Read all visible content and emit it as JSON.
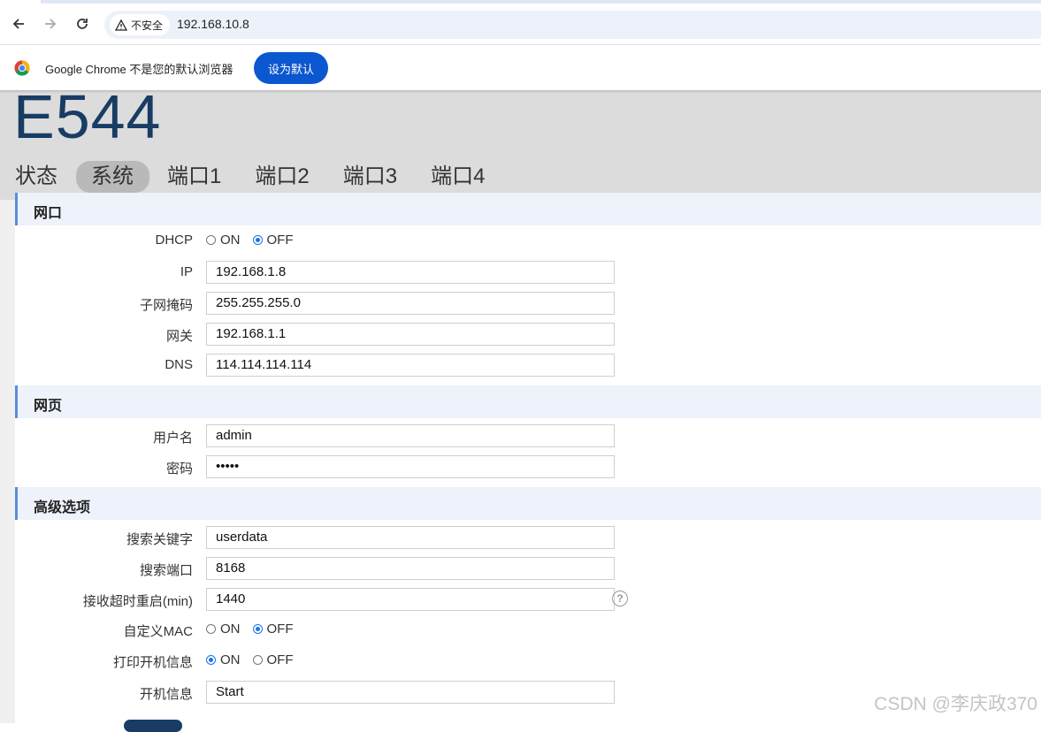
{
  "browser": {
    "security_label": "不安全",
    "url": "192.168.10.8",
    "infobar_text": "Google Chrome 不是您的默认浏览器",
    "set_default_label": "设为默认"
  },
  "header": {
    "brand": "E544",
    "nav": [
      {
        "label": "状态",
        "active": false
      },
      {
        "label": "系统",
        "active": true
      },
      {
        "label": "端口1",
        "active": false
      },
      {
        "label": "端口2",
        "active": false
      },
      {
        "label": "端口3",
        "active": false
      },
      {
        "label": "端口4",
        "active": false
      }
    ]
  },
  "sections": {
    "network": {
      "title": "网口",
      "dhcp": {
        "label": "DHCP",
        "on_label": "ON",
        "off_label": "OFF",
        "selected": "OFF"
      },
      "ip": {
        "label": "IP",
        "value": "192.168.1.8"
      },
      "subnet": {
        "label": "子网掩码",
        "value": "255.255.255.0"
      },
      "gateway": {
        "label": "网关",
        "value": "192.168.1.1"
      },
      "dns": {
        "label": "DNS",
        "value": "114.114.114.114"
      }
    },
    "web": {
      "title": "网页",
      "username": {
        "label": "用户名",
        "value": "admin"
      },
      "password": {
        "label": "密码",
        "value": "•••••"
      }
    },
    "advanced": {
      "title": "高级选项",
      "search_keyword": {
        "label": "搜索关键字",
        "value": "userdata"
      },
      "search_port": {
        "label": "搜索端口",
        "value": "8168"
      },
      "reboot": {
        "label": "接收超时重启(min)",
        "value": "1440"
      },
      "custom_mac": {
        "label": "自定义MAC",
        "on_label": "ON",
        "off_label": "OFF",
        "selected": "OFF"
      },
      "print_boot": {
        "label": "打印开机信息",
        "on_label": "ON",
        "off_label": "OFF",
        "selected": "ON"
      },
      "boot_info": {
        "label": "开机信息",
        "value": "Start"
      }
    }
  },
  "colors": {
    "brand": "#183c63",
    "accent": "#0b57d0",
    "section_bar": "#5b8cd6"
  },
  "watermark": "CSDN @李庆政370"
}
